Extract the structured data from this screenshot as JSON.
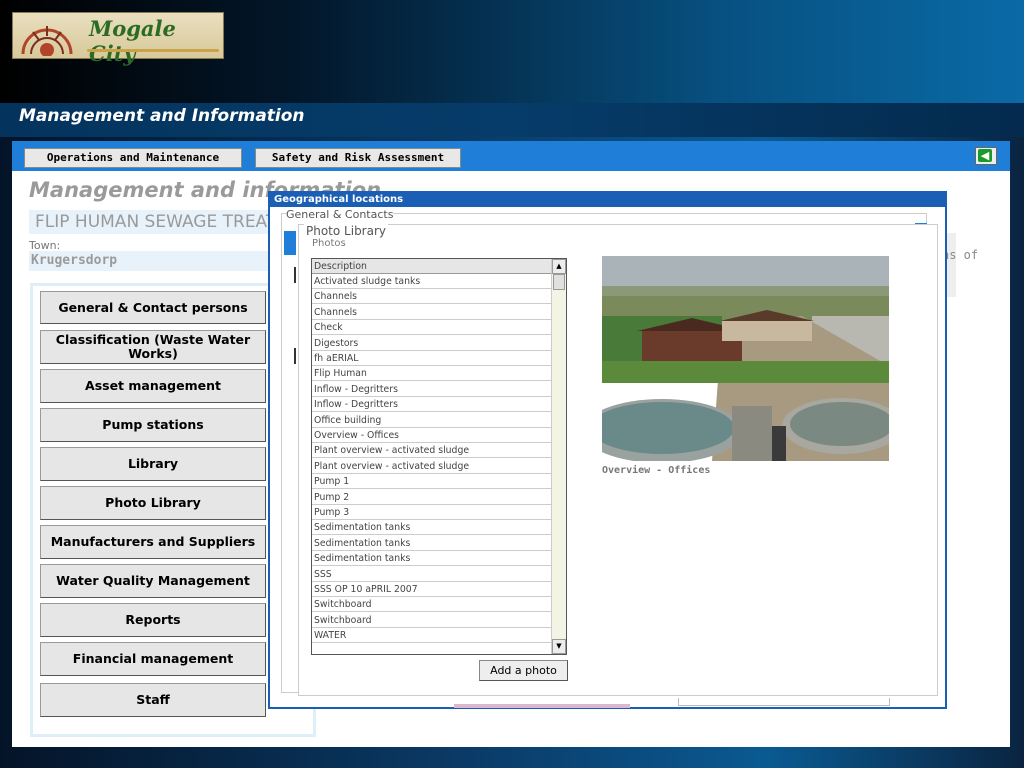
{
  "header": {
    "logo_text": "Mogale City",
    "section_title": "Management and Information"
  },
  "toolbar": {
    "tabs": [
      {
        "label": "Operations and Maintenance"
      },
      {
        "label": "Safety and Risk Assessment"
      }
    ],
    "back_icon": "back-arrow-icon"
  },
  "main": {
    "heading": "Management and information",
    "plant_name": "FLIP HUMAN SEWAGE TREATMENT",
    "town_label": "Town:",
    "town_value": "Krugersdorp",
    "side_text": "ns of"
  },
  "nav": {
    "items": [
      {
        "label": "General & Contact persons"
      },
      {
        "label": "Classification (Waste Water Works)"
      },
      {
        "label": "Asset management"
      },
      {
        "label": "Pump stations"
      },
      {
        "label": "Library"
      },
      {
        "label": "Photo Library"
      },
      {
        "label": "Manufacturers and Suppliers"
      },
      {
        "label": "Water Quality Management"
      },
      {
        "label": "Reports"
      },
      {
        "label": "Financial management"
      },
      {
        "label": "Staff"
      }
    ]
  },
  "geo_window": {
    "title": "Geographical locations",
    "legend": "General & Contacts"
  },
  "photo_library": {
    "legend": "Photo Library",
    "photos_label": "Photos",
    "list_header": "Description",
    "items": [
      "Activated sludge tanks",
      "Channels",
      "Channels",
      "Check",
      "Digestors",
      "fh aERIAL",
      "Flip Human",
      "Inflow - Degritters",
      "Inflow - Degritters",
      "Office building",
      "Overview - Offices",
      "Plant overview - activated sludge",
      "Plant overview - activated sludge",
      "Pump 1",
      "Pump 2",
      "Pump 3",
      "Sedimentation tanks",
      "Sedimentation tanks",
      "Sedimentation tanks",
      "SSS",
      "SSS OP 10 aPRIL 2007",
      "Switchboard",
      "Switchboard",
      "WATER"
    ],
    "add_button": "Add a photo",
    "selected_caption": "Overview - Offices"
  }
}
